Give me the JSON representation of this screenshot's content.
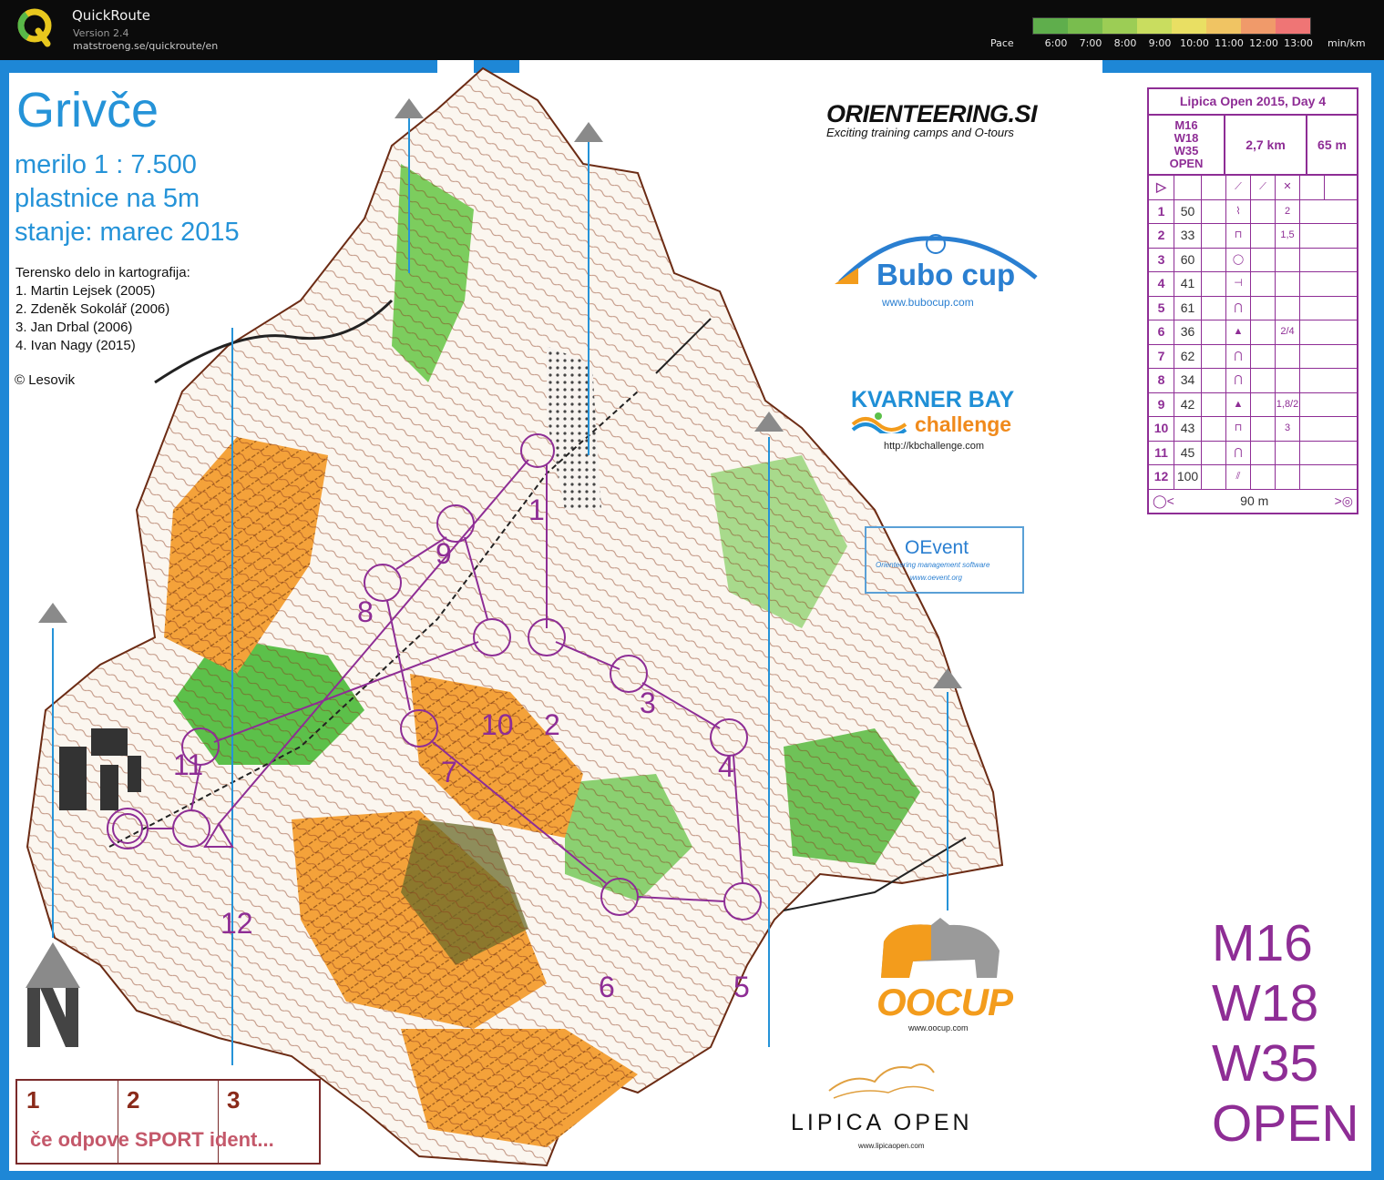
{
  "app": {
    "title": "QuickRoute",
    "version": "Version 2.4",
    "url": "matstroeng.se/quickroute/en"
  },
  "pace_legend": {
    "label": "Pace",
    "ticks": [
      "6:00",
      "7:00",
      "8:00",
      "9:00",
      "10:00",
      "11:00",
      "12:00",
      "13:00"
    ],
    "unit": "min/km",
    "colors": [
      "#5fae4c",
      "#79bd4e",
      "#9ccd55",
      "#c9dd5f",
      "#e9df63",
      "#f0c463",
      "#f09a6a",
      "#ef7575"
    ]
  },
  "map": {
    "name": "Grivče",
    "scale": "merilo 1 : 7.500",
    "contours": "plastnice na 5m",
    "state": "stanje: marec 2015",
    "credits_title": "Terensko delo in kartografija:",
    "credits": [
      "1. Martin Lejsek (2005)",
      "2. Zdeněk Sokolář (2006)",
      "3. Jan Drbal (2006)",
      "4. Ivan Nagy (2015)"
    ],
    "copyright": "© Lesovik",
    "colors": {
      "open": "#f4a23a",
      "forest": "#5cc04a",
      "contour": "#8b3a1c",
      "course": "#8e2d95",
      "water": "#2593d8"
    }
  },
  "description": {
    "title": "Lipica Open 2015, Day 4",
    "classes": [
      "M16",
      "W18",
      "W35",
      "OPEN"
    ],
    "length": "2,7 km",
    "climb": "65 m",
    "controls": [
      {
        "no": "1",
        "code": "50",
        "dim": "2"
      },
      {
        "no": "2",
        "code": "33",
        "dim": "1,5"
      },
      {
        "no": "3",
        "code": "60",
        "dim": ""
      },
      {
        "no": "4",
        "code": "41",
        "dim": ""
      },
      {
        "no": "5",
        "code": "61",
        "dim": ""
      },
      {
        "no": "6",
        "code": "36",
        "dim": "2/4"
      },
      {
        "no": "7",
        "code": "62",
        "dim": ""
      },
      {
        "no": "8",
        "code": "34",
        "dim": ""
      },
      {
        "no": "9",
        "code": "42",
        "dim": "1,8/2"
      },
      {
        "no": "10",
        "code": "43",
        "dim": "3"
      },
      {
        "no": "11",
        "code": "45",
        "dim": ""
      },
      {
        "no": "12",
        "code": "100",
        "dim": ""
      }
    ],
    "finish_distance": "90 m"
  },
  "sponsors": {
    "orienteering_si": "ORIENTEERING.SI",
    "orienteering_si_tag": "Exciting training camps and O-tours",
    "bubo": "Bubo cup",
    "bubo_url": "www.bubocup.com",
    "kvarner_1": "KVARNER BAY",
    "kvarner_2": "challenge",
    "kvarner_url": "http://kbchallenge.com",
    "oevent": "OEvent",
    "oevent_tag": "Orienteering management software",
    "oevent_url": "www.oevent.org",
    "oocup": "OOCUP",
    "oocup_url": "www.oocup.com",
    "lipica": "LIPICA OPEN",
    "lipica_url": "www.lipicaopen.com"
  },
  "class_labels": [
    "M16",
    "W18",
    "W35",
    "OPEN"
  ],
  "sport_box": {
    "cols": [
      "1",
      "2",
      "3"
    ],
    "note": "če odpove SPORT ident..."
  },
  "control_labels": [
    "1",
    "2",
    "3",
    "4",
    "5",
    "6",
    "7",
    "8",
    "9",
    "10",
    "11",
    "12"
  ]
}
